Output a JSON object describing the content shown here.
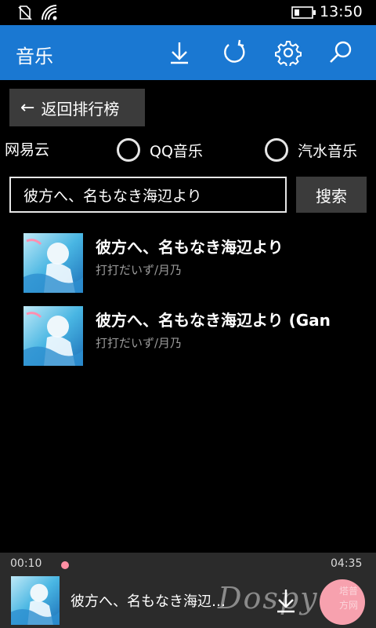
{
  "status_bar": {
    "time": "13:50"
  },
  "app_bar": {
    "title": "音乐",
    "accent": "#1a78d2"
  },
  "nav": {
    "back_label": "返回排行榜",
    "back_arrow": "←"
  },
  "sources": [
    {
      "label": "网易云",
      "selected": true
    },
    {
      "label": "QQ音乐",
      "selected": false
    },
    {
      "label": "汽水音乐",
      "selected": false
    }
  ],
  "search": {
    "value": "彼方へ、名もなき海辺より",
    "button_label": "搜索"
  },
  "results": [
    {
      "title": "彼方へ、名もなき海辺より",
      "artist": "打打だいず/月乃",
      "cover_icon": "album-art"
    },
    {
      "title": "彼方へ、名もなき海辺より (Gan",
      "artist": "打打だいず/月乃",
      "cover_icon": "album-art"
    }
  ],
  "player": {
    "current_time": "00:10",
    "total_time": "04:35",
    "title": "彼方へ、名もなき海辺…",
    "accent": "#f7a1ae"
  },
  "watermark": {
    "text": "Dospy",
    "sub": "塔普方网"
  }
}
